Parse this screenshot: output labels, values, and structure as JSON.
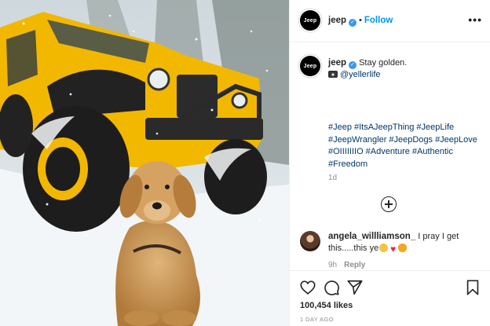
{
  "account": {
    "username": "jeep",
    "avatar_text": "Jeep",
    "verified_icon": "verified-badge-icon",
    "follow_label": "Follow",
    "separator": "•"
  },
  "caption": {
    "username": "jeep",
    "text": "Stay golden.",
    "photo_credit_icon": "camera-icon",
    "photo_credit": "@yellerlife"
  },
  "hashtags": [
    "#Jeep",
    "#ItsAJeepThing",
    "#JeepLife",
    "#JeepWrangler",
    "#JeepDogs",
    "#JeepLove",
    "#OIIIIIIIO",
    "#Adventure",
    "#Authentic",
    "#Freedom"
  ],
  "caption_age": "1d",
  "load_more_icon": "plus-circle-icon",
  "comment": {
    "username": "angela_willliamson_",
    "text": "I pray I get this.....this ye",
    "emojis": [
      "clapping-hands",
      "red-heart",
      "heart-eyes-face"
    ],
    "age": "9h",
    "reply_label": "Reply"
  },
  "actions": {
    "like_icon": "heart-icon",
    "comment_icon": "comment-bubble-icon",
    "share_icon": "paper-plane-icon",
    "save_icon": "bookmark-icon"
  },
  "likes_text": "100,454 likes",
  "timestamp": "1 DAY AGO",
  "photo": {
    "subject": "yellow-jeep-and-golden-retriever-in-snow",
    "colors": {
      "jeep_yellow": "#f2b800",
      "snow": "#f3f6f8",
      "dog": "#c9934f"
    }
  },
  "colors": {
    "link": "#00376b",
    "follow": "#0095f6",
    "muted": "#8e8e8e",
    "verified": "#3897f0"
  }
}
